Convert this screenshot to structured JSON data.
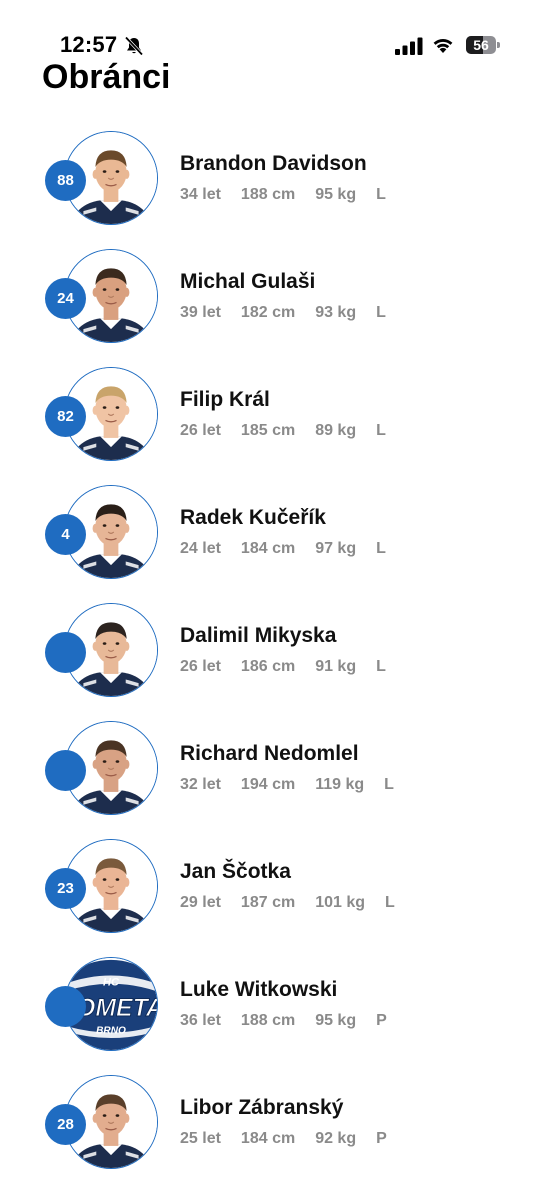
{
  "status_bar": {
    "time": "12:57",
    "battery_level": "56",
    "battery_fraction": 0.56
  },
  "page": {
    "title": "Obránci"
  },
  "players": [
    {
      "number": "88",
      "name": "Brandon Davidson",
      "age": "34 let",
      "height": "188 cm",
      "weight": "95 kg",
      "hand": "L",
      "photo": "player-photo",
      "hair": "#6b4a2b",
      "skin": "#e9b894"
    },
    {
      "number": "24",
      "name": "Michal Gulaši",
      "age": "39 let",
      "height": "182 cm",
      "weight": "93 kg",
      "hand": "L",
      "photo": "player-photo",
      "hair": "#3b2a1e",
      "skin": "#d9a07f"
    },
    {
      "number": "82",
      "name": "Filip Král",
      "age": "26 let",
      "height": "185 cm",
      "weight": "89 kg",
      "hand": "L",
      "photo": "player-photo",
      "hair": "#c9a46a",
      "skin": "#f0c4a4"
    },
    {
      "number": "4",
      "name": "Radek Kučeřík",
      "age": "24 let",
      "height": "184 cm",
      "weight": "97 kg",
      "hand": "L",
      "photo": "player-photo",
      "hair": "#2a1f18",
      "skin": "#e6b596"
    },
    {
      "number": "",
      "name": "Dalimil Mikyska",
      "age": "26 let",
      "height": "186 cm",
      "weight": "91 kg",
      "hand": "L",
      "photo": "player-photo",
      "hair": "#2d2420",
      "skin": "#e8b998"
    },
    {
      "number": "",
      "name": "Richard Nedomlel",
      "age": "32 let",
      "height": "194 cm",
      "weight": "119 kg",
      "hand": "L",
      "photo": "player-photo",
      "hair": "#4a3424",
      "skin": "#d8a284"
    },
    {
      "number": "23",
      "name": "Jan Ščotka",
      "age": "29 let",
      "height": "187 cm",
      "weight": "101 kg",
      "hand": "L",
      "photo": "player-photo",
      "hair": "#7a5a3c",
      "skin": "#eab595"
    },
    {
      "number": "",
      "name": "Luke Witkowski",
      "age": "36 let",
      "height": "188 cm",
      "weight": "95 kg",
      "hand": "P",
      "photo": "team-logo",
      "logo_text_top": "HC",
      "logo_text_main": "KOMETA",
      "logo_text_bottom": "BRNO"
    },
    {
      "number": "28",
      "name": "Libor Zábranský",
      "age": "25 let",
      "height": "184 cm",
      "weight": "92 kg",
      "hand": "P",
      "photo": "player-photo",
      "hair": "#5a3f2a",
      "skin": "#e2ad8e"
    }
  ],
  "colors": {
    "accent": "#1f6cc1",
    "jersey": "#1d2d4d",
    "stat_text": "#8a8a8a"
  }
}
